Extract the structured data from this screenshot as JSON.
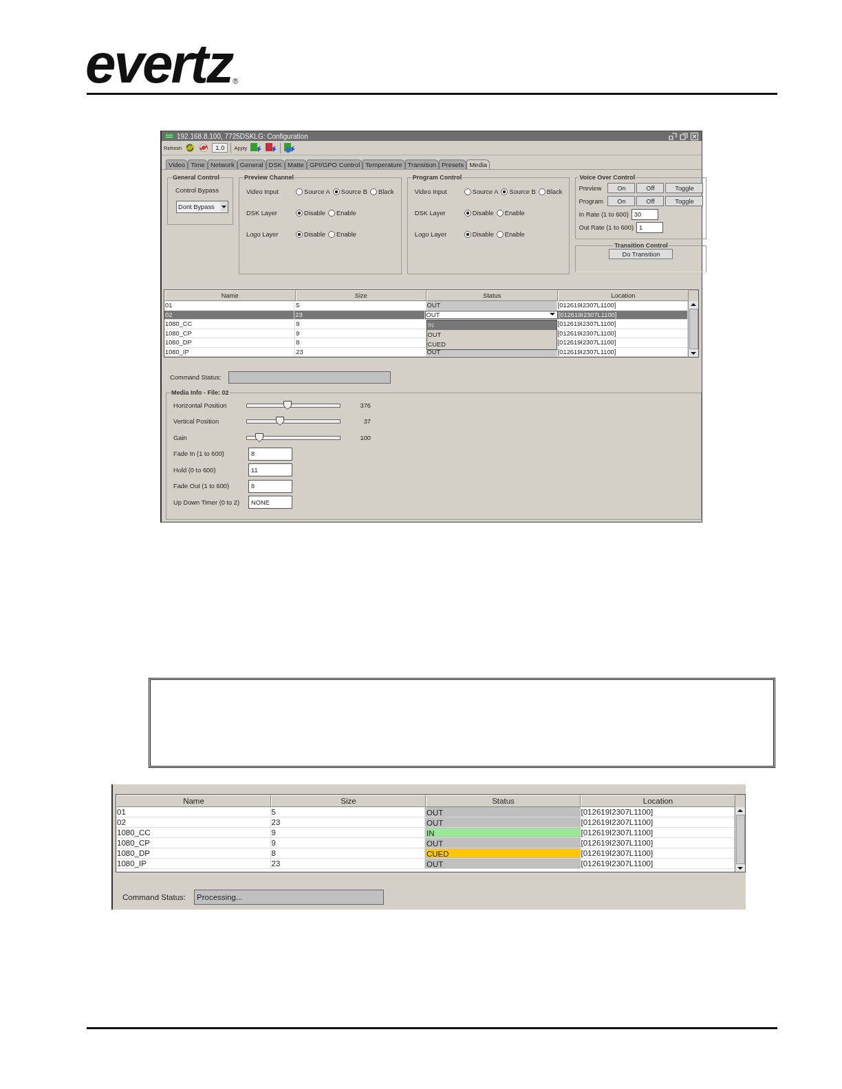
{
  "logo": {
    "wordmark": "evertz",
    "registered": "®"
  },
  "config_window": {
    "title": "192.168.8.100, 7725DSKLG: Configuration",
    "toolbar": {
      "refresh": "Refresh",
      "version": "1.0",
      "apply": "Apply"
    },
    "tabs": [
      {
        "label": "Video",
        "selected": false
      },
      {
        "label": "Time",
        "selected": false
      },
      {
        "label": "Network",
        "selected": false
      },
      {
        "label": "General",
        "selected": false
      },
      {
        "label": "DSK",
        "selected": false
      },
      {
        "label": "Matte",
        "selected": false
      },
      {
        "label": "GPI/GPO Control",
        "selected": false
      },
      {
        "label": "Temperature",
        "selected": false
      },
      {
        "label": "Transition",
        "selected": false
      },
      {
        "label": "Presets",
        "selected": false
      },
      {
        "label": "Media",
        "selected": true
      }
    ],
    "general_control": {
      "title": "General Control",
      "label": "Control Bypass",
      "value": "Dont Bypass"
    },
    "channels": [
      {
        "title": "Preview Channel",
        "rows": [
          {
            "label": "Video Input",
            "options": [
              {
                "label": "Source A",
                "selected": false
              },
              {
                "label": "Source B",
                "selected": true
              },
              {
                "label": "Black",
                "selected": false
              }
            ]
          },
          {
            "label": "DSK Layer",
            "options": [
              {
                "label": "Disable",
                "selected": true
              },
              {
                "label": "Enable",
                "selected": false
              }
            ]
          },
          {
            "label": "Logo Layer",
            "options": [
              {
                "label": "Disable",
                "selected": true
              },
              {
                "label": "Enable",
                "selected": false
              }
            ]
          }
        ]
      },
      {
        "title": "Program Control",
        "rows": [
          {
            "label": "Video Input",
            "options": [
              {
                "label": "Source A",
                "selected": false
              },
              {
                "label": "Source B",
                "selected": true
              },
              {
                "label": "Black",
                "selected": false
              }
            ]
          },
          {
            "label": "DSK Layer",
            "options": [
              {
                "label": "Disable",
                "selected": true
              },
              {
                "label": "Enable",
                "selected": false
              }
            ]
          },
          {
            "label": "Logo Layer",
            "options": [
              {
                "label": "Disable",
                "selected": true
              },
              {
                "label": "Enable",
                "selected": false
              }
            ]
          }
        ]
      }
    ],
    "voice_over": {
      "title": "Voice Over Control",
      "rows": [
        {
          "label": "Preview",
          "buttons": [
            "On",
            "Off",
            "Toggle"
          ]
        },
        {
          "label": "Program",
          "buttons": [
            "On",
            "Off",
            "Toggle"
          ]
        }
      ],
      "fields": [
        {
          "label": "In Rate (1 to 600)",
          "value": "30"
        },
        {
          "label": "Out Rate (1 to 600)",
          "value": "1"
        }
      ]
    },
    "transition": {
      "title": "Transition Control",
      "button": "Do Transition"
    },
    "table": {
      "columns": [
        "Name",
        "Size",
        "Status",
        "Location"
      ],
      "rows": [
        {
          "name": "01",
          "size": "5",
          "status": "OUT",
          "location": "[012619I2307L1100]",
          "selected": false
        },
        {
          "name": "02",
          "size": "23",
          "status": "OUT",
          "location": "[012619I2307L1100]",
          "selected": true
        },
        {
          "name": "1080_CC",
          "size": "9",
          "location": "[012619I2307L1100]",
          "selected": false
        },
        {
          "name": "1080_CP",
          "size": "9",
          "location": "[012619I2307L1100]",
          "selected": false
        },
        {
          "name": "1080_DP",
          "size": "8",
          "location": "[012619I2307L1100]",
          "selected": false
        },
        {
          "name": "1080_IP",
          "size": "23",
          "status": "OUT",
          "location": "[012619I2307L1100]",
          "selected": false
        }
      ],
      "dropdown": [
        {
          "label": "IN",
          "selected": true
        },
        {
          "label": "OUT",
          "selected": false
        },
        {
          "label": "CUED",
          "selected": false
        }
      ]
    },
    "command_status": {
      "label": "Command Status:"
    },
    "media_info": {
      "title": "Media Info - File: 02",
      "sliders": [
        {
          "label": "Horizontal Position",
          "level": 0.43,
          "reading": "376"
        },
        {
          "label": "Vertical Position",
          "level": 0.34,
          "reading": "37"
        },
        {
          "label": "Gain",
          "level": 0.1,
          "reading": "100"
        }
      ],
      "fields": [
        {
          "label": "Fade In (1 to 600)",
          "value": "8"
        },
        {
          "label": "Hold (0 to 600)",
          "value": "11"
        },
        {
          "label": "Fade Out (1 to 600)",
          "value": "8"
        },
        {
          "label": "Up Down Timer (0 to 2)",
          "value": "NONE"
        }
      ]
    }
  },
  "status_view": {
    "columns": [
      "Name",
      "Size",
      "Status",
      "Location"
    ],
    "rows": [
      {
        "name": "01",
        "size": "5",
        "status": "OUT",
        "color": "#c0c0c0",
        "location": "[012619I2307L1100]"
      },
      {
        "name": "02",
        "size": "23",
        "status": "OUT",
        "color": "#c0c0c0",
        "location": "[012619I2307L1100]"
      },
      {
        "name": "1080_CC",
        "size": "9",
        "status": "IN",
        "color": "#98e898",
        "location": "[012619I2307L1100]"
      },
      {
        "name": "1080_CP",
        "size": "9",
        "status": "OUT",
        "color": "#c0c0c0",
        "location": "[012619I2307L1100]"
      },
      {
        "name": "1080_DP",
        "size": "8",
        "status": "CUED",
        "color": "#ffc800",
        "location": "[012619I2307L1100]"
      },
      {
        "name": "1080_IP",
        "size": "23",
        "status": "OUT",
        "color": "#c0c0c0",
        "location": "[012619I2307L1100]"
      }
    ],
    "command_status": {
      "label": "Command Status:",
      "value": "Processing..."
    }
  }
}
